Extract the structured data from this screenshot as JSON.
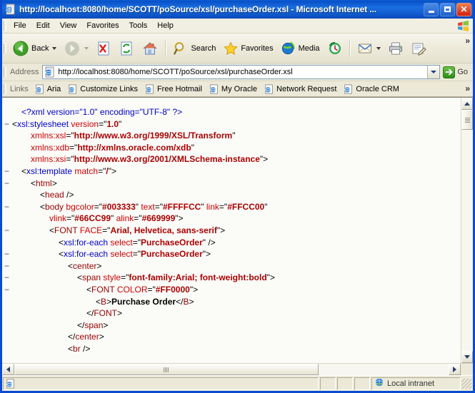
{
  "window": {
    "title": "http://localhost:8080/home/SCOTT/poSource/xsl/purchaseOrder.xsl - Microsoft Internet ...",
    "icon": "ie-document-icon",
    "minimize_label": "Minimize",
    "maximize_label": "Maximize",
    "close_label": "Close"
  },
  "menu": {
    "items": [
      {
        "label": "File"
      },
      {
        "label": "Edit"
      },
      {
        "label": "View"
      },
      {
        "label": "Favorites"
      },
      {
        "label": "Tools"
      },
      {
        "label": "Help"
      }
    ],
    "logo": "windows-flag-logo"
  },
  "toolbar": {
    "back_label": "Back",
    "forward_label": "",
    "stop_label": "",
    "refresh_label": "",
    "home_label": "",
    "search_label": "Search",
    "favorites_label": "Favorites",
    "media_label": "Media",
    "history_label": "",
    "mail_label": "",
    "print_label": "",
    "edit_label": "",
    "overflow_label": "»"
  },
  "address": {
    "label": "Address",
    "value": "http://localhost:8080/home/SCOTT/poSource/xsl/purchaseOrder.xsl",
    "placeholder": "Address",
    "go_label": "Go"
  },
  "links": {
    "label": "Links",
    "items": [
      {
        "label": "Aria"
      },
      {
        "label": "Customize Links"
      },
      {
        "label": "Free Hotmail"
      },
      {
        "label": "My Oracle"
      },
      {
        "label": "Network Request"
      },
      {
        "label": "Oracle CRM"
      }
    ],
    "overflow_label": "»"
  },
  "content": {
    "lines": [
      {
        "indent": 1,
        "collapse": false,
        "tokens": [
          {
            "t": "<?xml version=\"1.0\" encoding=\"UTF-8\" ?>",
            "c": "b"
          }
        ]
      },
      {
        "indent": 0,
        "collapse": true,
        "tokens": [
          {
            "t": "<",
            "c": "k"
          },
          {
            "t": "xsl:stylesheet",
            "c": "b"
          },
          {
            "t": " ",
            "c": "k"
          },
          {
            "t": "version",
            "c": "an"
          },
          {
            "t": "=\"",
            "c": "k"
          },
          {
            "t": "1.0",
            "c": "av"
          },
          {
            "t": "\"",
            "c": "k"
          }
        ]
      },
      {
        "indent": 2,
        "collapse": false,
        "tokens": [
          {
            "t": "xmlns:xsl",
            "c": "an"
          },
          {
            "t": "=\"",
            "c": "k"
          },
          {
            "t": "http://www.w3.org/1999/XSL/Transform",
            "c": "av"
          },
          {
            "t": "\"",
            "c": "k"
          }
        ]
      },
      {
        "indent": 2,
        "collapse": false,
        "tokens": [
          {
            "t": "xmlns:xdb",
            "c": "an"
          },
          {
            "t": "=\"",
            "c": "k"
          },
          {
            "t": "http://xmlns.oracle.com/xdb",
            "c": "av"
          },
          {
            "t": "\"",
            "c": "k"
          }
        ]
      },
      {
        "indent": 2,
        "collapse": false,
        "tokens": [
          {
            "t": "xmlns:xsi",
            "c": "an"
          },
          {
            "t": "=\"",
            "c": "k"
          },
          {
            "t": "http://www.w3.org/2001/XMLSchema-instance",
            "c": "av"
          },
          {
            "t": "\">",
            "c": "k"
          }
        ]
      },
      {
        "indent": 1,
        "collapse": true,
        "tokens": [
          {
            "t": "<",
            "c": "k"
          },
          {
            "t": "xsl:template",
            "c": "b"
          },
          {
            "t": " ",
            "c": "k"
          },
          {
            "t": "match",
            "c": "an"
          },
          {
            "t": "=\"",
            "c": "k"
          },
          {
            "t": "/",
            "c": "av"
          },
          {
            "t": "\">",
            "c": "k"
          }
        ]
      },
      {
        "indent": 2,
        "collapse": true,
        "tokens": [
          {
            "t": "<",
            "c": "k"
          },
          {
            "t": "html",
            "c": "r"
          },
          {
            "t": ">",
            "c": "k"
          }
        ]
      },
      {
        "indent": 3,
        "collapse": false,
        "tokens": [
          {
            "t": "<",
            "c": "k"
          },
          {
            "t": "head",
            "c": "r"
          },
          {
            "t": " />",
            "c": "k"
          }
        ]
      },
      {
        "indent": 3,
        "collapse": true,
        "tokens": [
          {
            "t": "<",
            "c": "k"
          },
          {
            "t": "body",
            "c": "r"
          },
          {
            "t": " ",
            "c": "k"
          },
          {
            "t": "bgcolor",
            "c": "an"
          },
          {
            "t": "=\"",
            "c": "k"
          },
          {
            "t": "#003333",
            "c": "av"
          },
          {
            "t": "\" ",
            "c": "k"
          },
          {
            "t": "text",
            "c": "an"
          },
          {
            "t": "=\"",
            "c": "k"
          },
          {
            "t": "#FFFFCC",
            "c": "av"
          },
          {
            "t": "\" ",
            "c": "k"
          },
          {
            "t": "link",
            "c": "an"
          },
          {
            "t": "=\"",
            "c": "k"
          },
          {
            "t": "#FFCC00",
            "c": "av"
          },
          {
            "t": "\"",
            "c": "k"
          }
        ]
      },
      {
        "indent": 4,
        "collapse": false,
        "tokens": [
          {
            "t": "vlink",
            "c": "an"
          },
          {
            "t": "=\"",
            "c": "k"
          },
          {
            "t": "#66CC99",
            "c": "av"
          },
          {
            "t": "\" ",
            "c": "k"
          },
          {
            "t": "alink",
            "c": "an"
          },
          {
            "t": "=\"",
            "c": "k"
          },
          {
            "t": "#669999",
            "c": "av"
          },
          {
            "t": "\">",
            "c": "k"
          }
        ]
      },
      {
        "indent": 4,
        "collapse": true,
        "tokens": [
          {
            "t": "<",
            "c": "k"
          },
          {
            "t": "FONT",
            "c": "r"
          },
          {
            "t": " ",
            "c": "k"
          },
          {
            "t": "FACE",
            "c": "an"
          },
          {
            "t": "=\"",
            "c": "k"
          },
          {
            "t": "Arial, Helvetica, sans-serif",
            "c": "av"
          },
          {
            "t": "\">",
            "c": "k"
          }
        ]
      },
      {
        "indent": 5,
        "collapse": false,
        "tokens": [
          {
            "t": "<",
            "c": "k"
          },
          {
            "t": "xsl:for-each",
            "c": "b"
          },
          {
            "t": " ",
            "c": "k"
          },
          {
            "t": "select",
            "c": "an"
          },
          {
            "t": "=\"",
            "c": "k"
          },
          {
            "t": "PurchaseOrder",
            "c": "av"
          },
          {
            "t": "\" />",
            "c": "k"
          }
        ]
      },
      {
        "indent": 5,
        "collapse": true,
        "tokens": [
          {
            "t": "<",
            "c": "k"
          },
          {
            "t": "xsl:for-each",
            "c": "b"
          },
          {
            "t": " ",
            "c": "k"
          },
          {
            "t": "select",
            "c": "an"
          },
          {
            "t": "=\"",
            "c": "k"
          },
          {
            "t": "PurchaseOrder",
            "c": "av"
          },
          {
            "t": "\">",
            "c": "k"
          }
        ]
      },
      {
        "indent": 6,
        "collapse": true,
        "tokens": [
          {
            "t": "<",
            "c": "k"
          },
          {
            "t": "center",
            "c": "r"
          },
          {
            "t": ">",
            "c": "k"
          }
        ]
      },
      {
        "indent": 7,
        "collapse": true,
        "tokens": [
          {
            "t": "<",
            "c": "k"
          },
          {
            "t": "span",
            "c": "r"
          },
          {
            "t": " ",
            "c": "k"
          },
          {
            "t": "style",
            "c": "an"
          },
          {
            "t": "=\"",
            "c": "k"
          },
          {
            "t": "font-family:Arial; font-weight:bold",
            "c": "av"
          },
          {
            "t": "\">",
            "c": "k"
          }
        ]
      },
      {
        "indent": 8,
        "collapse": true,
        "tokens": [
          {
            "t": "<",
            "c": "k"
          },
          {
            "t": "FONT",
            "c": "r"
          },
          {
            "t": " ",
            "c": "k"
          },
          {
            "t": "COLOR",
            "c": "an"
          },
          {
            "t": "=\"",
            "c": "k"
          },
          {
            "t": "#FF0000",
            "c": "av"
          },
          {
            "t": "\">",
            "c": "k"
          }
        ]
      },
      {
        "indent": 9,
        "collapse": false,
        "tokens": [
          {
            "t": "<",
            "c": "k"
          },
          {
            "t": "B",
            "c": "r"
          },
          {
            "t": ">",
            "c": "k"
          },
          {
            "t": "Purchase Order",
            "c": "txt"
          },
          {
            "t": "</",
            "c": "k"
          },
          {
            "t": "B",
            "c": "r"
          },
          {
            "t": ">",
            "c": "k"
          }
        ]
      },
      {
        "indent": 8,
        "collapse": false,
        "tokens": [
          {
            "t": "</",
            "c": "k"
          },
          {
            "t": "FONT",
            "c": "r"
          },
          {
            "t": ">",
            "c": "k"
          }
        ]
      },
      {
        "indent": 7,
        "collapse": false,
        "tokens": [
          {
            "t": "</",
            "c": "k"
          },
          {
            "t": "span",
            "c": "r"
          },
          {
            "t": ">",
            "c": "k"
          }
        ]
      },
      {
        "indent": 6,
        "collapse": false,
        "tokens": [
          {
            "t": "</",
            "c": "k"
          },
          {
            "t": "center",
            "c": "r"
          },
          {
            "t": ">",
            "c": "k"
          }
        ]
      },
      {
        "indent": 6,
        "collapse": false,
        "tokens": [
          {
            "t": "<",
            "c": "k"
          },
          {
            "t": "br",
            "c": "r"
          },
          {
            "t": " />",
            "c": "k"
          }
        ]
      }
    ]
  },
  "statusbar": {
    "message": "",
    "zone": "Local intranet",
    "zone_icon": "globe-icon",
    "page_icon": "ie-document-icon"
  },
  "colors": {
    "tag_blue": "#0000cc",
    "tag_maroon": "#990000",
    "attr_name": "#cc0000",
    "attr_value": "#aa0000",
    "title_gradient": "#0a50c8",
    "content_bg": "#fbfbf8"
  }
}
